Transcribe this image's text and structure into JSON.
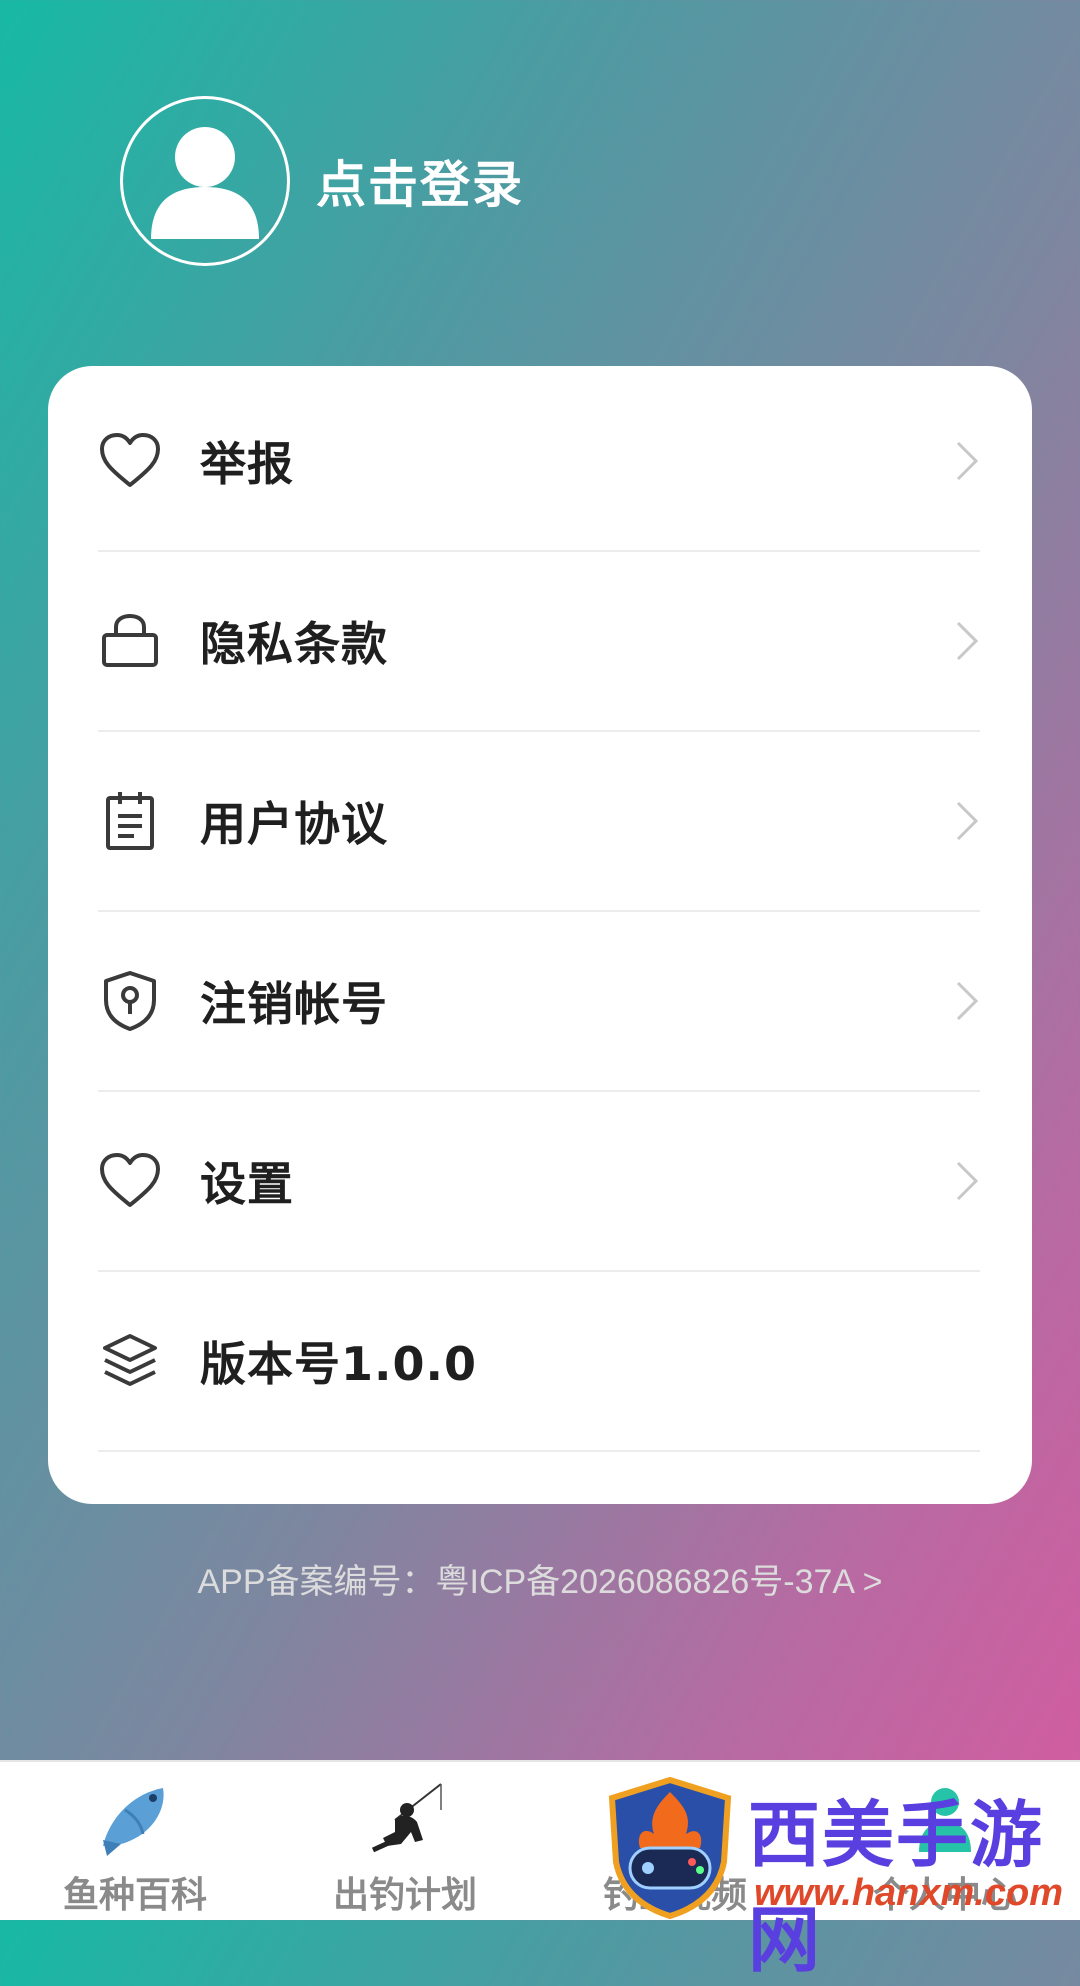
{
  "profile": {
    "login_label": "点击登录"
  },
  "menu": {
    "items": [
      {
        "label": "举报",
        "icon": "heart-icon",
        "chevron": true
      },
      {
        "label": "隐私条款",
        "icon": "lock-icon",
        "chevron": true
      },
      {
        "label": "用户协议",
        "icon": "document-icon",
        "chevron": true
      },
      {
        "label": "注销帐号",
        "icon": "shield-icon",
        "chevron": true
      },
      {
        "label": "设置",
        "icon": "heart-icon",
        "chevron": true
      },
      {
        "label": "版本号1.0.0",
        "icon": "layers-icon",
        "chevron": false
      }
    ]
  },
  "icp": {
    "text": "APP备案编号：粤ICP备2026086826号-37A >"
  },
  "bottom_nav": {
    "items": [
      {
        "label": "鱼种百科",
        "icon": "fish-icon"
      },
      {
        "label": "出钓计划",
        "icon": "angler-icon"
      },
      {
        "label": "钓鱼视频",
        "icon": "video-icon"
      },
      {
        "label": "个人中心",
        "icon": "person-icon"
      }
    ]
  },
  "watermark": {
    "title": "西美手游网",
    "url": "www.hanxm.com"
  },
  "colors": {
    "gradient_start": "#17b9a5",
    "gradient_end": "#d65aa0",
    "card_bg": "#ffffff",
    "label_text": "#1f1f1f",
    "nav_text": "#8a8a8a"
  }
}
